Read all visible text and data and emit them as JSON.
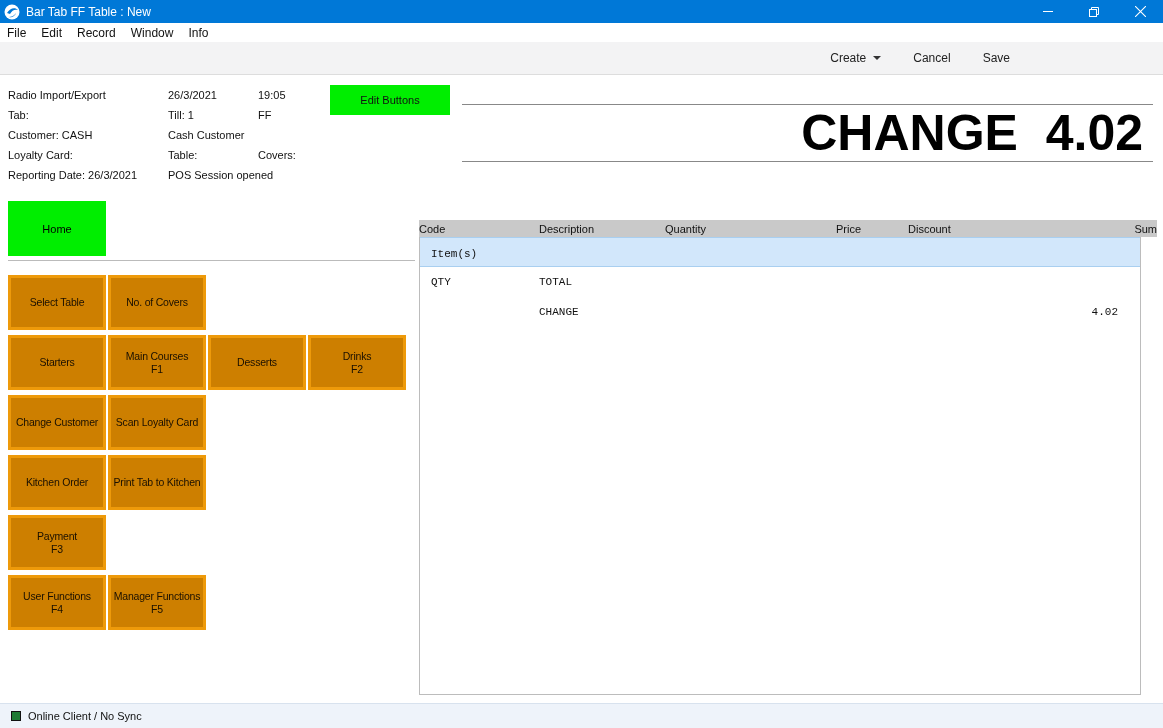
{
  "window": {
    "title": "Bar Tab FF Table : New"
  },
  "menu": [
    "File",
    "Edit",
    "Record",
    "Window",
    "Info"
  ],
  "toolbar": [
    {
      "label": "Create",
      "kind": "dropdown"
    },
    {
      "label": "Cancel",
      "kind": "plain"
    },
    {
      "label": "Save",
      "kind": "plain"
    }
  ],
  "info": [
    [
      "Radio Import/Export",
      "26/3/2021",
      "19:05"
    ],
    [
      "Tab:",
      "Till: 1",
      "FF"
    ],
    [
      "Customer: CASH",
      "Cash Customer"
    ],
    [
      "Loyalty Card:",
      "Table:",
      "Covers:"
    ],
    [
      "Reporting Date: 26/3/2021",
      "POS Session opened"
    ]
  ],
  "edit_button": "Edit Buttons",
  "display": "CHANGE  4.02",
  "home_button": "Home",
  "pos_buttons": [
    [
      {
        "label": "Select Table"
      },
      {
        "label": "No. of  Covers"
      }
    ],
    [
      {
        "label": "Starters"
      },
      {
        "label": "Main Courses",
        "shortcut": "F1"
      },
      {
        "label": "Desserts"
      },
      {
        "label": "Drinks",
        "shortcut": "F2"
      }
    ],
    [
      {
        "label": "Change Customer"
      },
      {
        "label": "Scan Loyalty Card"
      }
    ],
    [
      {
        "label": "Kitchen Order"
      },
      {
        "label": "Print Tab to Kitchen"
      }
    ],
    [
      {
        "label": "Payment",
        "shortcut": "F3"
      }
    ],
    [
      {
        "label": "User Functions",
        "shortcut": "F4"
      },
      {
        "label": "Manager Functions",
        "shortcut": "F5"
      }
    ]
  ],
  "table": {
    "columns": [
      "Code",
      "Description",
      "Quantity",
      "Price",
      "Discount",
      "Sum"
    ],
    "rows": [
      {
        "kind": "group",
        "code": "Item(s)"
      },
      {
        "kind": "line",
        "code": "QTY",
        "description": "TOTAL"
      },
      {
        "kind": "line",
        "description": "CHANGE",
        "sum": "4.02"
      }
    ]
  },
  "status_bar": {
    "text": "Online Client / No Sync",
    "color": "#1e7a34"
  }
}
